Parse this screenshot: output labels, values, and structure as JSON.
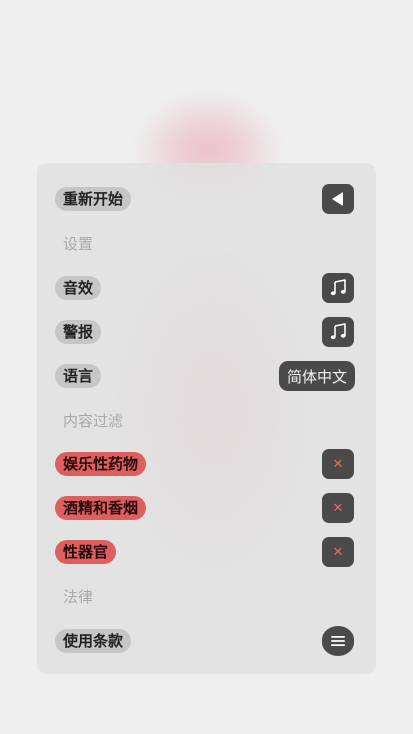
{
  "menu": {
    "restart": {
      "label": "重新开始",
      "icon": "back-triangle-icon"
    },
    "settings_header": "设置",
    "sound": {
      "label": "音效",
      "icon": "music-note-icon"
    },
    "alert": {
      "label": "警报",
      "icon": "music-note-icon"
    },
    "language": {
      "label": "语言",
      "value": "简体中文"
    },
    "content_filter_header": "内容过滤",
    "filters": [
      {
        "label": "娱乐性药物",
        "icon": "close-icon"
      },
      {
        "label": "酒精和香烟",
        "icon": "close-icon"
      },
      {
        "label": "性器官",
        "icon": "close-icon"
      }
    ],
    "legal_header": "法律",
    "terms": {
      "label": "使用条款",
      "icon": "menu-icon"
    }
  },
  "colors": {
    "panel": "#e1e1e1",
    "pill": "#c6c6c6",
    "pill_red": "#dd5f5f",
    "button": "#4a4a4a",
    "section_text": "#a9a9a9",
    "close_x": "#e06a6a"
  },
  "glyphs": {
    "close": "✕"
  }
}
